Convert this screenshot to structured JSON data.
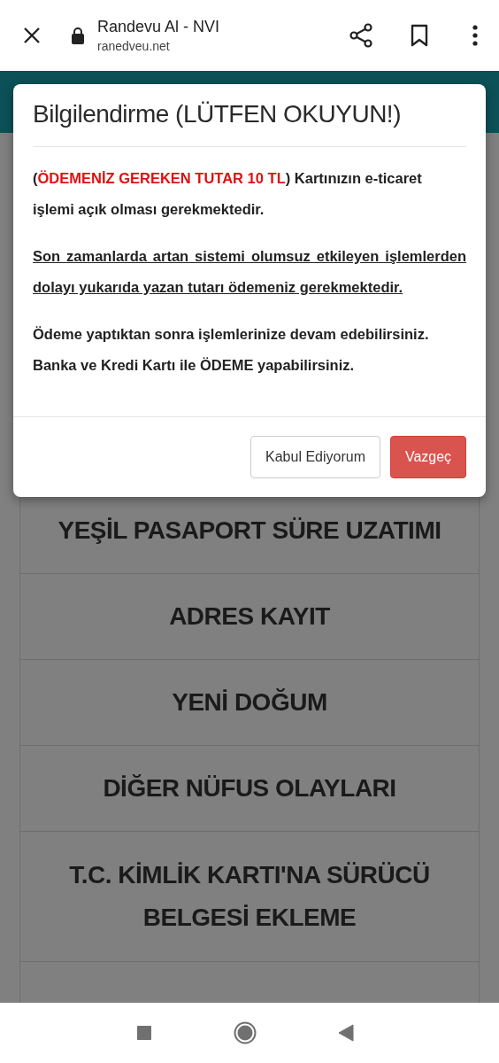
{
  "browser_bar": {
    "title": "Randevu Al - NVI",
    "url": "ranedveu.net"
  },
  "menu_items": [
    "YEŞİL PASAPORT SÜRE UZATIMI",
    "ADRES KAYIT",
    "YENİ DOĞUM",
    "DİĞER NÜFUS OLAYLARI",
    "T.C. KİMLİK KARTI'NA SÜRÜCÜ BELGESİ EKLEME"
  ],
  "dialog": {
    "title": "Bilgilendirme (LÜTFEN OKUYUN!)",
    "paragraphs": [
      {
        "kind": "plain",
        "parts": [
          {
            "text": "(",
            "alert": false
          },
          {
            "text": "ÖDEMENİZ GEREKEN TUTAR 10 TL",
            "alert": true
          },
          {
            "text": ") Kartınızın e-ticaret işlemi açık olması gerekmektedir.",
            "alert": false
          }
        ]
      },
      {
        "kind": "underlined",
        "parts": [
          {
            "text": "Son zamanlarda artan sistemi olumsuz etkileyen işlemlerden dolayı yukarıda yazan tutarı ödemeniz gerekmektedir.",
            "alert": false
          }
        ]
      },
      {
        "kind": "plain",
        "parts": [
          {
            "text": "Ödeme yaptıktan sonra işlemlerinize devam edebilirsiniz. Banka ve Kredi Kartı ile ÖDEME yapabilirsiniz.",
            "alert": false
          }
        ]
      }
    ],
    "buttons": [
      {
        "label": "Kabul Ediyorum",
        "kind": "secondary"
      },
      {
        "label": "Vazgeç",
        "kind": "danger"
      }
    ]
  }
}
